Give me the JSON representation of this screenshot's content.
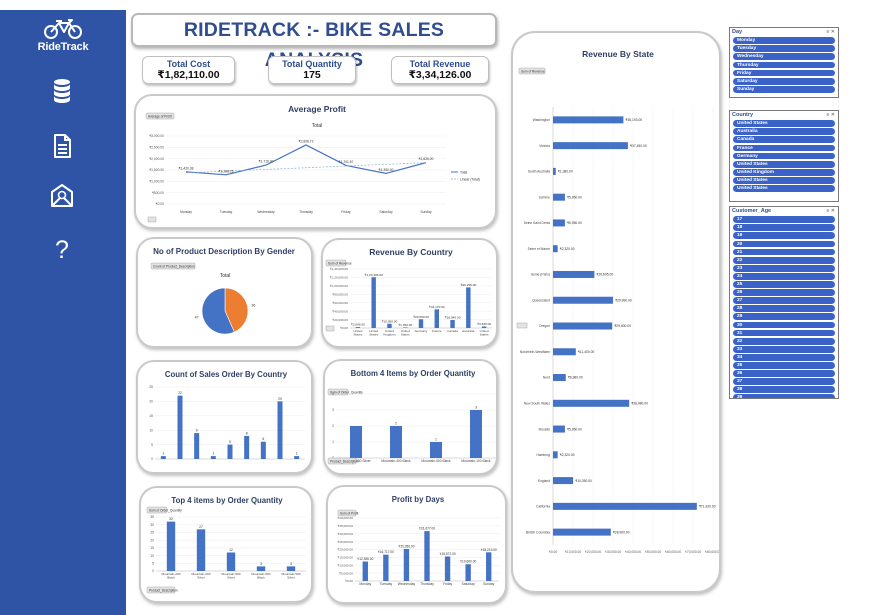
{
  "brand": {
    "name": "RideTrack"
  },
  "sidebar": {
    "icons": [
      "database-icon",
      "document-icon",
      "mail-icon",
      "help-icon"
    ],
    "help_glyph": "?"
  },
  "header": {
    "title": "RIDETRACK :- BIKE SALES ANALYSIS"
  },
  "kpis": [
    {
      "label": "Total Cost",
      "value": "₹1,82,110.00"
    },
    {
      "label": "Total Quantity",
      "value": "175"
    },
    {
      "label": "Total Revenue",
      "value": "₹3,34,126.00"
    }
  ],
  "colors": {
    "sidebar": "#2f54a5",
    "bar": "#4472c4",
    "pie_orange": "#ed7d31",
    "title": "#2f4d8f"
  },
  "chart_data": [
    {
      "id": "average-profit",
      "type": "line",
      "title": "Average Profit",
      "subtitle": "Total",
      "filter_button": "Average of Profit",
      "categories": [
        "Monday",
        "Tuesday",
        "Wednesday",
        "Thursday",
        "Friday",
        "Saturday",
        "Sunday"
      ],
      "series": [
        {
          "name": "Total",
          "values": [
            1420.38,
            1288.25,
            1716.0,
            2606.72,
            1701.67,
            1350.0,
            1826.0
          ]
        },
        {
          "name": "Linear (Total)",
          "values": [
            1375,
            1450,
            1525,
            1600,
            1675,
            1750,
            1825
          ]
        }
      ],
      "data_labels": [
        "₹1,420.38",
        "₹1,288.25",
        "₹1,716.00",
        "₹2,606.72",
        "₹1,701.67",
        "₹1,350.00",
        "₹1,826.00"
      ],
      "yticks": [
        "₹0.00",
        "₹500.00",
        "₹1,000.00",
        "₹1,500.00",
        "₹2,000.00",
        "₹2,500.00",
        "₹3,000.00"
      ],
      "ylim": [
        0,
        3000
      ],
      "legend": "right"
    },
    {
      "id": "gender-pie",
      "type": "pie",
      "title": "No of Product Description By Gender",
      "subtitle": "Total",
      "filter_button": "Count of Product_Description",
      "slices": [
        {
          "label": "36",
          "value": 36,
          "color": "#ed7d31"
        },
        {
          "label": "47",
          "value": 47,
          "color": "#4472c4"
        }
      ]
    },
    {
      "id": "revenue-by-country",
      "type": "bar",
      "title": "Revenue By Country",
      "filter_button": "Sum of Revenue",
      "categories": [
        "United States",
        "United States",
        "United Kingdom",
        "United States",
        "Germany",
        "France",
        "Canada",
        "Australia",
        "United States"
      ],
      "values": [
        2096,
        120405,
        10050,
        1350,
        20650,
        44170,
        18940,
        96295,
        3530
      ],
      "data_labels": [
        "₹2,096.00",
        "₹1,20,405.00",
        "₹10,050.00",
        "₹1,350.00",
        "₹20,650.00",
        "₹44,170.00",
        "₹18,940.00",
        "₹96,295.00",
        "₹3,530.00"
      ],
      "yticks": [
        "₹0.00",
        "₹20,000.00",
        "₹40,000.00",
        "₹60,000.00",
        "₹80,000.00",
        "₹1,00,000.00",
        "₹1,20,000.00",
        "₹1,40,000.00"
      ],
      "ylim": [
        0,
        140000
      ]
    },
    {
      "id": "sales-order-by-country",
      "type": "bar",
      "title": "Count of Sales Order By Country",
      "categories": [
        "",
        "",
        "",
        "",
        "",
        "",
        "",
        "",
        ""
      ],
      "values": [
        1,
        22,
        9,
        1,
        5,
        8,
        6,
        20,
        1
      ],
      "yticks": [
        "0",
        "5",
        "10",
        "15",
        "20",
        "25"
      ],
      "ylim": [
        0,
        25
      ]
    },
    {
      "id": "bottom-4-items",
      "type": "bar",
      "title": "Bottom 4 Items by Order Quantity",
      "filter_button": "Sum of Order_Quantity",
      "categories": [
        "Mountain-500 Silver",
        "Mountain-400 Black",
        "Mountain-500 Black",
        "Mountain-100 Black"
      ],
      "values": [
        2,
        2,
        1,
        3
      ],
      "data_labels": [
        "",
        "2",
        "1",
        "3"
      ],
      "yticks": [
        "0",
        "1",
        "2",
        "3",
        "4"
      ],
      "ylim": [
        0,
        4
      ],
      "bottom_button": "Product_Description"
    },
    {
      "id": "top-4-items",
      "type": "bar",
      "title": "Top 4 items by Order Quantity",
      "filter_button": "Sum of Order_Quantity",
      "categories": [
        "Mountain-200 Black",
        "Mountain-200 Silver",
        "Mountain-500 Silver",
        "Mountain-500 Black",
        "Mountain-500 Silver"
      ],
      "values": [
        32,
        27,
        12,
        3,
        3
      ],
      "data_labels": [
        "32",
        "27",
        "12",
        "3",
        "3"
      ],
      "yticks": [
        "0",
        "5",
        "10",
        "15",
        "20",
        "25",
        "30",
        "35"
      ],
      "ylim": [
        0,
        35
      ],
      "bottom_button": "Product_Description"
    },
    {
      "id": "profit-by-days",
      "type": "bar",
      "title": "Profit by Days",
      "filter_button": "Sum of Profit",
      "categories": [
        "Monday",
        "Tuesday",
        "Wednesday",
        "Thursday",
        "Friday",
        "Saturday",
        "Sunday"
      ],
      "values": [
        12356,
        16717,
        20350,
        31677,
        15572,
        10660,
        18213
      ],
      "data_labels": [
        "₹12,356.00",
        "₹16,717.00",
        "₹20,350.00",
        "₹31,677.00",
        "₹15,572.00",
        "₹10,660.00",
        "₹18,213.00"
      ],
      "yticks": [
        "₹0.00",
        "₹5,000.00",
        "₹10,000.00",
        "₹15,000.00",
        "₹20,000.00",
        "₹25,000.00",
        "₹30,000.00",
        "₹35,000.00",
        "₹40,000.00"
      ],
      "ylim": [
        0,
        40000
      ]
    },
    {
      "id": "revenue-by-state",
      "type": "bar",
      "orientation": "horizontal",
      "title": "Revenue By State",
      "filter_button": "Sum of Revenue",
      "categories": [
        "Washington",
        "Victoria",
        "South Australia",
        "Somme",
        "Seine Saint Denis",
        "Seine et Marne",
        "Seine (Paris)",
        "Queensland",
        "Oregon",
        "Nordrhein-Westfalen",
        "Nord",
        "New South Wales",
        "Moselle",
        "Hamburg",
        "England",
        "California",
        "British Columbia"
      ],
      "values": [
        35193,
        37450,
        1380,
        5950,
        5950,
        2320,
        20695,
        29990,
        29600,
        11400,
        6380,
        38080,
        5950,
        2320,
        10050,
        71920,
        28900
      ],
      "data_labels": [
        "₹35,193.00",
        "₹37,450.00",
        "₹1,380.00",
        "₹5,950.00",
        "₹5,950.00",
        "₹2,320.00",
        "₹20,695.00",
        "₹29,990.00",
        "₹29,600.00",
        "₹11,400.00",
        "₹6,380.00",
        "₹38,080.00",
        "₹5,950.00",
        "₹2,320.00",
        "₹10,050.00",
        "₹71,920.00",
        "₹28,900.00"
      ],
      "xticks": [
        "₹0.00",
        "₹10,000.00",
        "₹20,000.00",
        "₹30,000.00",
        "₹40,000.00",
        "₹50,000.00",
        "₹60,000.00",
        "₹70,000.00",
        "₹80,000.00"
      ],
      "xlim": [
        0,
        80000
      ]
    }
  ],
  "slicers": {
    "day": {
      "title": "Day",
      "items": [
        "Monday",
        "Tuesday",
        "Wednesday",
        "Thursday",
        "Friday",
        "Saturday",
        "Sunday"
      ]
    },
    "country": {
      "title": "Country",
      "items": [
        "United States",
        "Australia",
        "Canada",
        "France",
        "Germany",
        "United States",
        "United Kingdom",
        "United States",
        "United States"
      ]
    },
    "age": {
      "title": "Customer_Age",
      "items": [
        "17",
        "18",
        "19",
        "20",
        "21",
        "22",
        "23",
        "24",
        "25",
        "26",
        "27",
        "28",
        "29",
        "30",
        "31",
        "32",
        "33",
        "34",
        "35",
        "36",
        "37",
        "38",
        "39",
        "40"
      ]
    }
  }
}
